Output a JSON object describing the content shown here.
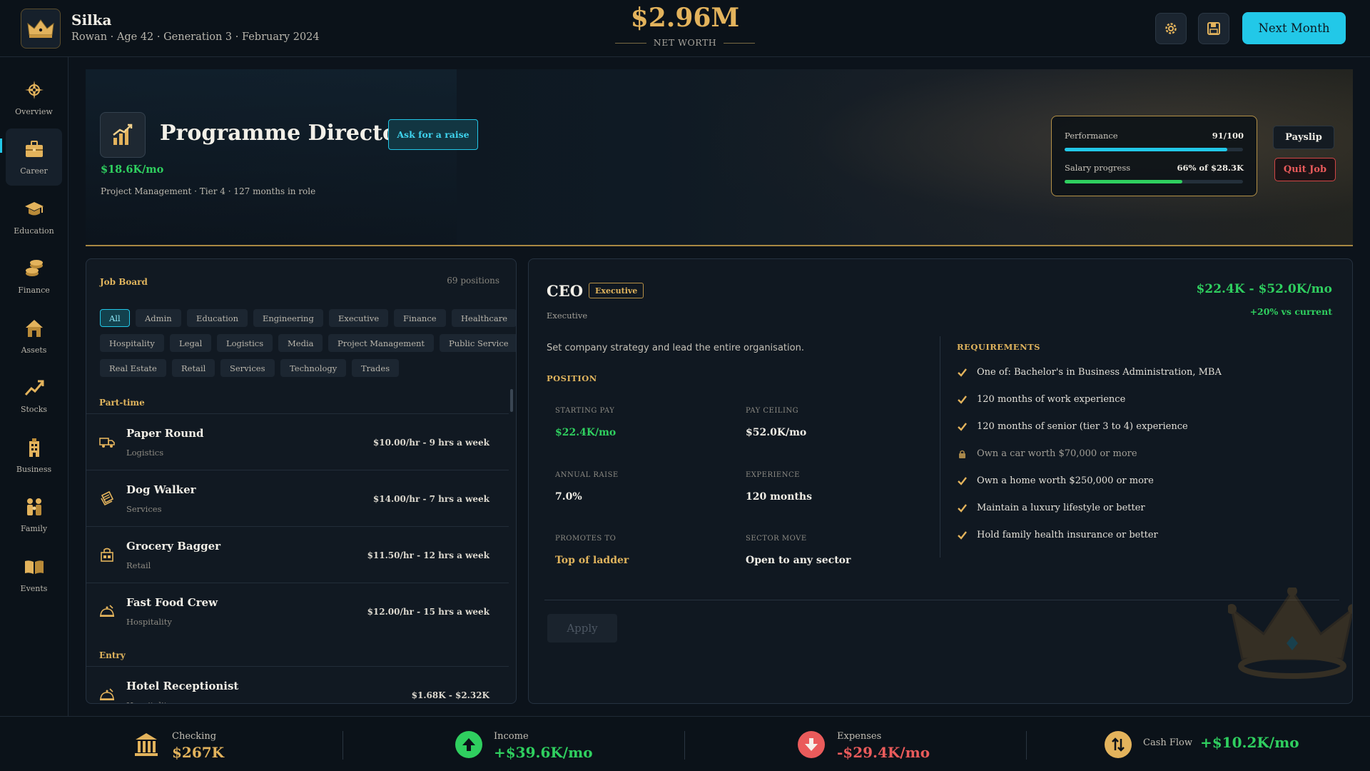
{
  "player": {
    "name": "Silka",
    "subtitle": "Rowan · Age 42 · Generation 3 · February 2024"
  },
  "net_worth": {
    "value": "$2.96M",
    "label": "NET WORTH"
  },
  "toolbar": {
    "next_month_label": "Next Month",
    "settings_icon": "gear-icon",
    "save_icon": "floppy-disk-icon"
  },
  "nav": [
    {
      "label": "Overview",
      "icon": "compass-icon",
      "active": false
    },
    {
      "label": "Career",
      "icon": "briefcase-icon",
      "active": true
    },
    {
      "label": "Education",
      "icon": "graduation-cap-icon",
      "active": false
    },
    {
      "label": "Finance",
      "icon": "coins-icon",
      "active": false
    },
    {
      "label": "Assets",
      "icon": "house-icon",
      "active": false
    },
    {
      "label": "Stocks",
      "icon": "trend-up-icon",
      "active": false
    },
    {
      "label": "Business",
      "icon": "building-icon",
      "active": false
    },
    {
      "label": "Family",
      "icon": "family-icon",
      "active": false
    },
    {
      "label": "Events",
      "icon": "book-icon",
      "active": false
    }
  ],
  "current_job": {
    "title": "Programme Director",
    "raise_label": "Ask for a raise",
    "salary": "$18.6K/mo",
    "meta": "Project Management · Tier 4 · 127 months in role",
    "performance_label": "Performance",
    "performance_value": "91/100",
    "performance_fraction": 0.91,
    "salary_progress_label": "Salary progress",
    "salary_progress_value": "66% of $28.3K",
    "salary_progress_fraction": 0.66,
    "payslip_label": "Payslip",
    "quit_label": "Quit Job"
  },
  "job_board": {
    "title": "Job Board",
    "count": "69 positions",
    "filters": [
      "All",
      "Admin",
      "Education",
      "Engineering",
      "Executive",
      "Finance",
      "Healthcare",
      "Hospitality",
      "Legal",
      "Logistics",
      "Media",
      "Project Management",
      "Public Service",
      "Real Estate",
      "Retail",
      "Services",
      "Technology",
      "Trades"
    ],
    "active_filter": "All",
    "groups": [
      {
        "label": "Part-time"
      },
      {
        "label": "Entry"
      }
    ],
    "jobs": [
      {
        "name": "Paper Round",
        "sector": "Logistics",
        "pay": "$10.00/hr - 9 hrs a week",
        "icon": "truck-icon"
      },
      {
        "name": "Dog Walker",
        "sector": "Services",
        "pay": "$14.00/hr - 7 hrs a week",
        "icon": "clipboard-icon"
      },
      {
        "name": "Grocery Bagger",
        "sector": "Retail",
        "pay": "$11.50/hr - 12 hrs a week",
        "icon": "shop-icon"
      },
      {
        "name": "Fast Food Crew",
        "sector": "Hospitality",
        "pay": "$12.00/hr - 15 hrs a week",
        "icon": "service-bell-icon"
      },
      {
        "name": "Hotel Receptionist",
        "sector": "Hospitality",
        "pay": "$1.68K - $2.32K",
        "icon": "service-bell-icon"
      }
    ]
  },
  "detail": {
    "title": "CEO",
    "badge": "Executive",
    "sector": "Executive",
    "pay_range": "$22.4K - $52.0K/mo",
    "delta": "+20% vs current",
    "description": "Set company strategy and lead the entire organisation.",
    "position_heading": "POSITION",
    "stats": {
      "starting_pay_label": "STARTING PAY",
      "starting_pay": "$22.4K/mo",
      "pay_ceiling_label": "PAY CEILING",
      "pay_ceiling": "$52.0K/mo",
      "annual_raise_label": "ANNUAL RAISE",
      "annual_raise": "7.0%",
      "experience_label": "EXPERIENCE",
      "experience": "120 months",
      "promotes_to_label": "PROMOTES TO",
      "promotes_to": "Top of ladder",
      "sector_move_label": "SECTOR MOVE",
      "sector_move": "Open to any sector"
    },
    "requirements_heading": "REQUIREMENTS",
    "requirements": [
      {
        "text": "One of: Bachelor's in Business Administration, MBA",
        "met": true
      },
      {
        "text": "120 months of work experience",
        "met": true
      },
      {
        "text": "120 months of senior (tier 3 to 4) experience",
        "met": true
      },
      {
        "text": "Own a car worth $70,000 or more",
        "met": false
      },
      {
        "text": "Own a home worth $250,000 or more",
        "met": true
      },
      {
        "text": "Maintain a luxury lifestyle or better",
        "met": true
      },
      {
        "text": "Hold family health insurance or better",
        "met": true
      }
    ],
    "apply_label": "Apply"
  },
  "footer": {
    "checking_label": "Checking",
    "checking_value": "$267K",
    "income_label": "Income",
    "income_value": "+$39.6K/mo",
    "expenses_label": "Expenses",
    "expenses_value": "-$29.4K/mo",
    "cashflow_label": "Cash Flow",
    "cashflow_value": "+$10.2K/mo"
  },
  "colors": {
    "gold": "#e3b35c",
    "cyan": "#22c8e8",
    "green": "#2fcf5f",
    "red": "#ea5b5b"
  }
}
